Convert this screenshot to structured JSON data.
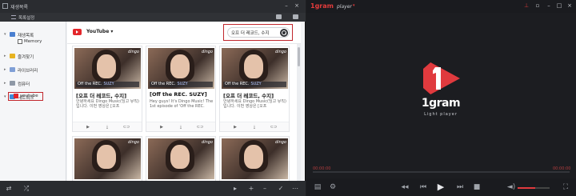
{
  "left_window": {
    "title": "재생목록",
    "toolbar_label": "목록설정"
  },
  "sidebar": {
    "items": [
      {
        "label": "재생목록",
        "sub": "Memory"
      },
      {
        "label": "즐겨찾기"
      },
      {
        "label": "라이브러리"
      },
      {
        "label": "컴퓨터"
      },
      {
        "label": "네트워크",
        "sub": "youtube"
      }
    ]
  },
  "source": {
    "label": "YouTube",
    "dropdown_icon": "caret-down-icon"
  },
  "search": {
    "value": "오프 더 레코드, 수지"
  },
  "cards": [
    {
      "title": "[오프 더 레코드, 수지]",
      "caption": "Off the REC.",
      "caption_tag": "SUZY",
      "desc": "안녕하세요 Dingo Music(딩고 뮤직)입니다. 이번 영상은 [오프",
      "badge": "dingo"
    },
    {
      "title": "[Off the REC. SUZY]",
      "caption": "Off the REC.",
      "caption_tag": "SUZY",
      "desc": "Hey guys! It's Dingo Music! The 1st episode of 'Off the REC.",
      "badge": "dingo"
    },
    {
      "title": "[오프 더 레코드, 수지]",
      "caption": "Off the REC.",
      "caption_tag": "SUZY",
      "desc": "안녕하세요 Dingo Music(딩고 뮤직)입니다. 이번 영상은 [오프",
      "badge": "dingo"
    },
    {
      "title": "",
      "caption": "",
      "caption_tag": "",
      "desc": "",
      "badge": "dingo"
    },
    {
      "title": "",
      "caption": "",
      "caption_tag": "",
      "desc": "",
      "badge": "dingo"
    },
    {
      "title": "",
      "caption": "",
      "caption_tag": "",
      "desc": "",
      "badge": "dingo"
    }
  ],
  "player": {
    "brand": "1gram",
    "brand_sub": "player",
    "logo_text": "1gram",
    "logo_sub": "Light player",
    "time_current": "00:00:00",
    "time_total": "00:00:00",
    "progress": 0,
    "volume": 0.55
  },
  "colors": {
    "accent": "#e03a3e",
    "highlight_box": "#c1272d"
  }
}
